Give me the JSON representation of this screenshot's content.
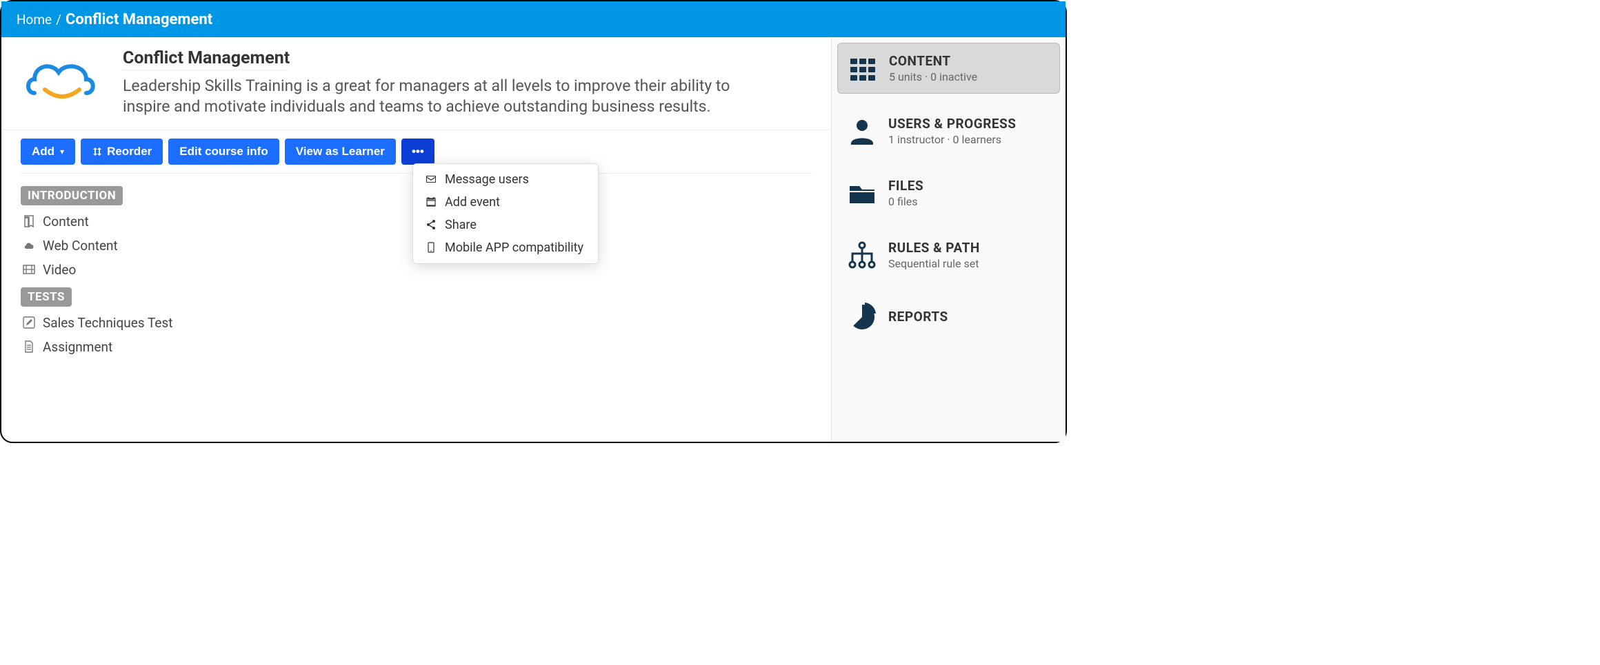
{
  "breadcrumb": {
    "home": "Home",
    "sep": "/",
    "current": "Conflict Management"
  },
  "course": {
    "title": "Conflict Management",
    "description": "Leadership Skills Training is a great for managers at all levels to improve their ability to inspire and motivate individuals and teams to achieve outstanding business results."
  },
  "toolbar": {
    "add": "Add",
    "reorder": "Reorder",
    "edit": "Edit course info",
    "view_as": "View as Learner",
    "more": "•••"
  },
  "more_menu": {
    "message_users": "Message users",
    "add_event": "Add event",
    "share": "Share",
    "mobile": "Mobile APP compatibility"
  },
  "sections": {
    "s0": {
      "label": "INTRODUCTION"
    },
    "s1": {
      "label": "TESTS"
    }
  },
  "units": {
    "u0": {
      "title": "Content"
    },
    "u1": {
      "title": "Web Content"
    },
    "u2": {
      "title": "Video"
    },
    "u3": {
      "title": "Sales Techniques Test"
    },
    "u4": {
      "title": "Assignment"
    }
  },
  "sidebar": {
    "content": {
      "title": "CONTENT",
      "sub": "5 units · 0 inactive"
    },
    "users": {
      "title": "USERS & PROGRESS",
      "sub": "1 instructor · 0 learners"
    },
    "files": {
      "title": "FILES",
      "sub": "0 files"
    },
    "rules": {
      "title": "RULES & PATH",
      "sub": "Sequential rule set"
    },
    "reports": {
      "title": "REPORTS",
      "sub": ""
    }
  }
}
